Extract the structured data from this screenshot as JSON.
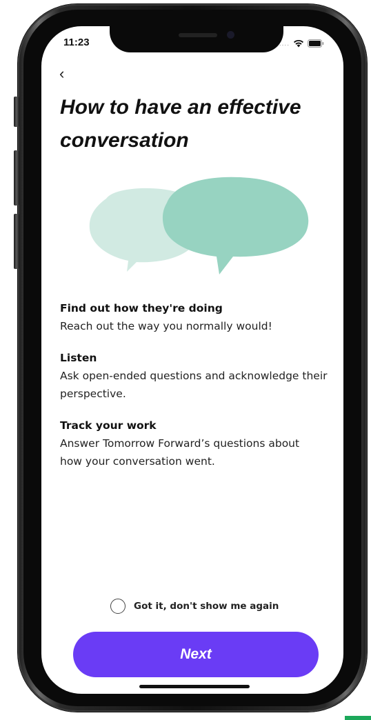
{
  "status_bar": {
    "time": "11:23",
    "signal_dots": "....",
    "icons": [
      "wifi-icon",
      "battery-icon"
    ]
  },
  "nav": {
    "back_label": "‹"
  },
  "page": {
    "title": "How to have an effective conversation"
  },
  "illustration": {
    "icon": "speech-bubbles-illustration",
    "colors": {
      "bubble_front": "#97d3c1",
      "bubble_back": "#cfe9e0"
    }
  },
  "tips": [
    {
      "title": "Find out how they're doing",
      "body": "Reach out the way you normally would!"
    },
    {
      "title": "Listen",
      "body": "Ask open-ended questions and acknowledge their perspective."
    },
    {
      "title": "Track your work",
      "body": "Answer Tomorrow Forward’s questions about how your conversation went."
    }
  ],
  "dont_show_again": {
    "label": "Got it, don't show me again",
    "checked": false
  },
  "next_button": {
    "label": "Next"
  },
  "colors": {
    "accent": "#6a3cf5",
    "text": "#111111"
  }
}
